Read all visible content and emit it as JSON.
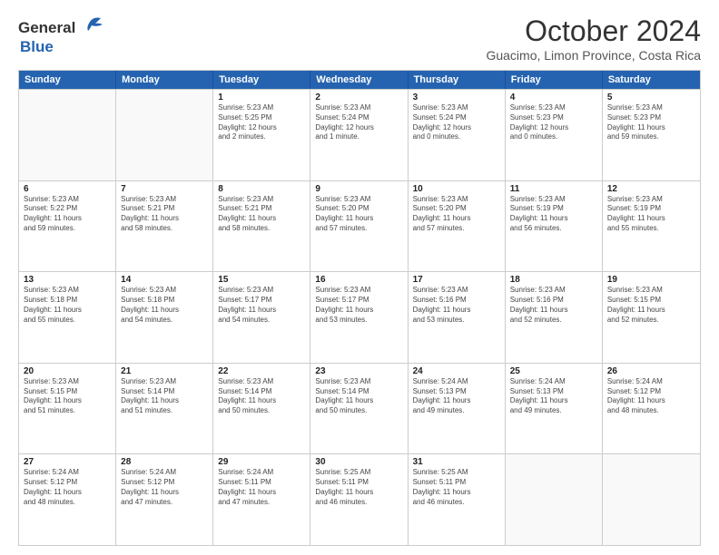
{
  "header": {
    "logo_general": "General",
    "logo_blue": "Blue",
    "month_title": "October 2024",
    "location": "Guacimo, Limon Province, Costa Rica"
  },
  "weekdays": [
    "Sunday",
    "Monday",
    "Tuesday",
    "Wednesday",
    "Thursday",
    "Friday",
    "Saturday"
  ],
  "weeks": [
    [
      {
        "day": "",
        "info": ""
      },
      {
        "day": "",
        "info": ""
      },
      {
        "day": "1",
        "info": "Sunrise: 5:23 AM\nSunset: 5:25 PM\nDaylight: 12 hours\nand 2 minutes."
      },
      {
        "day": "2",
        "info": "Sunrise: 5:23 AM\nSunset: 5:24 PM\nDaylight: 12 hours\nand 1 minute."
      },
      {
        "day": "3",
        "info": "Sunrise: 5:23 AM\nSunset: 5:24 PM\nDaylight: 12 hours\nand 0 minutes."
      },
      {
        "day": "4",
        "info": "Sunrise: 5:23 AM\nSunset: 5:23 PM\nDaylight: 12 hours\nand 0 minutes."
      },
      {
        "day": "5",
        "info": "Sunrise: 5:23 AM\nSunset: 5:23 PM\nDaylight: 11 hours\nand 59 minutes."
      }
    ],
    [
      {
        "day": "6",
        "info": "Sunrise: 5:23 AM\nSunset: 5:22 PM\nDaylight: 11 hours\nand 59 minutes."
      },
      {
        "day": "7",
        "info": "Sunrise: 5:23 AM\nSunset: 5:21 PM\nDaylight: 11 hours\nand 58 minutes."
      },
      {
        "day": "8",
        "info": "Sunrise: 5:23 AM\nSunset: 5:21 PM\nDaylight: 11 hours\nand 58 minutes."
      },
      {
        "day": "9",
        "info": "Sunrise: 5:23 AM\nSunset: 5:20 PM\nDaylight: 11 hours\nand 57 minutes."
      },
      {
        "day": "10",
        "info": "Sunrise: 5:23 AM\nSunset: 5:20 PM\nDaylight: 11 hours\nand 57 minutes."
      },
      {
        "day": "11",
        "info": "Sunrise: 5:23 AM\nSunset: 5:19 PM\nDaylight: 11 hours\nand 56 minutes."
      },
      {
        "day": "12",
        "info": "Sunrise: 5:23 AM\nSunset: 5:19 PM\nDaylight: 11 hours\nand 55 minutes."
      }
    ],
    [
      {
        "day": "13",
        "info": "Sunrise: 5:23 AM\nSunset: 5:18 PM\nDaylight: 11 hours\nand 55 minutes."
      },
      {
        "day": "14",
        "info": "Sunrise: 5:23 AM\nSunset: 5:18 PM\nDaylight: 11 hours\nand 54 minutes."
      },
      {
        "day": "15",
        "info": "Sunrise: 5:23 AM\nSunset: 5:17 PM\nDaylight: 11 hours\nand 54 minutes."
      },
      {
        "day": "16",
        "info": "Sunrise: 5:23 AM\nSunset: 5:17 PM\nDaylight: 11 hours\nand 53 minutes."
      },
      {
        "day": "17",
        "info": "Sunrise: 5:23 AM\nSunset: 5:16 PM\nDaylight: 11 hours\nand 53 minutes."
      },
      {
        "day": "18",
        "info": "Sunrise: 5:23 AM\nSunset: 5:16 PM\nDaylight: 11 hours\nand 52 minutes."
      },
      {
        "day": "19",
        "info": "Sunrise: 5:23 AM\nSunset: 5:15 PM\nDaylight: 11 hours\nand 52 minutes."
      }
    ],
    [
      {
        "day": "20",
        "info": "Sunrise: 5:23 AM\nSunset: 5:15 PM\nDaylight: 11 hours\nand 51 minutes."
      },
      {
        "day": "21",
        "info": "Sunrise: 5:23 AM\nSunset: 5:14 PM\nDaylight: 11 hours\nand 51 minutes."
      },
      {
        "day": "22",
        "info": "Sunrise: 5:23 AM\nSunset: 5:14 PM\nDaylight: 11 hours\nand 50 minutes."
      },
      {
        "day": "23",
        "info": "Sunrise: 5:23 AM\nSunset: 5:14 PM\nDaylight: 11 hours\nand 50 minutes."
      },
      {
        "day": "24",
        "info": "Sunrise: 5:24 AM\nSunset: 5:13 PM\nDaylight: 11 hours\nand 49 minutes."
      },
      {
        "day": "25",
        "info": "Sunrise: 5:24 AM\nSunset: 5:13 PM\nDaylight: 11 hours\nand 49 minutes."
      },
      {
        "day": "26",
        "info": "Sunrise: 5:24 AM\nSunset: 5:12 PM\nDaylight: 11 hours\nand 48 minutes."
      }
    ],
    [
      {
        "day": "27",
        "info": "Sunrise: 5:24 AM\nSunset: 5:12 PM\nDaylight: 11 hours\nand 48 minutes."
      },
      {
        "day": "28",
        "info": "Sunrise: 5:24 AM\nSunset: 5:12 PM\nDaylight: 11 hours\nand 47 minutes."
      },
      {
        "day": "29",
        "info": "Sunrise: 5:24 AM\nSunset: 5:11 PM\nDaylight: 11 hours\nand 47 minutes."
      },
      {
        "day": "30",
        "info": "Sunrise: 5:25 AM\nSunset: 5:11 PM\nDaylight: 11 hours\nand 46 minutes."
      },
      {
        "day": "31",
        "info": "Sunrise: 5:25 AM\nSunset: 5:11 PM\nDaylight: 11 hours\nand 46 minutes."
      },
      {
        "day": "",
        "info": ""
      },
      {
        "day": "",
        "info": ""
      }
    ]
  ]
}
